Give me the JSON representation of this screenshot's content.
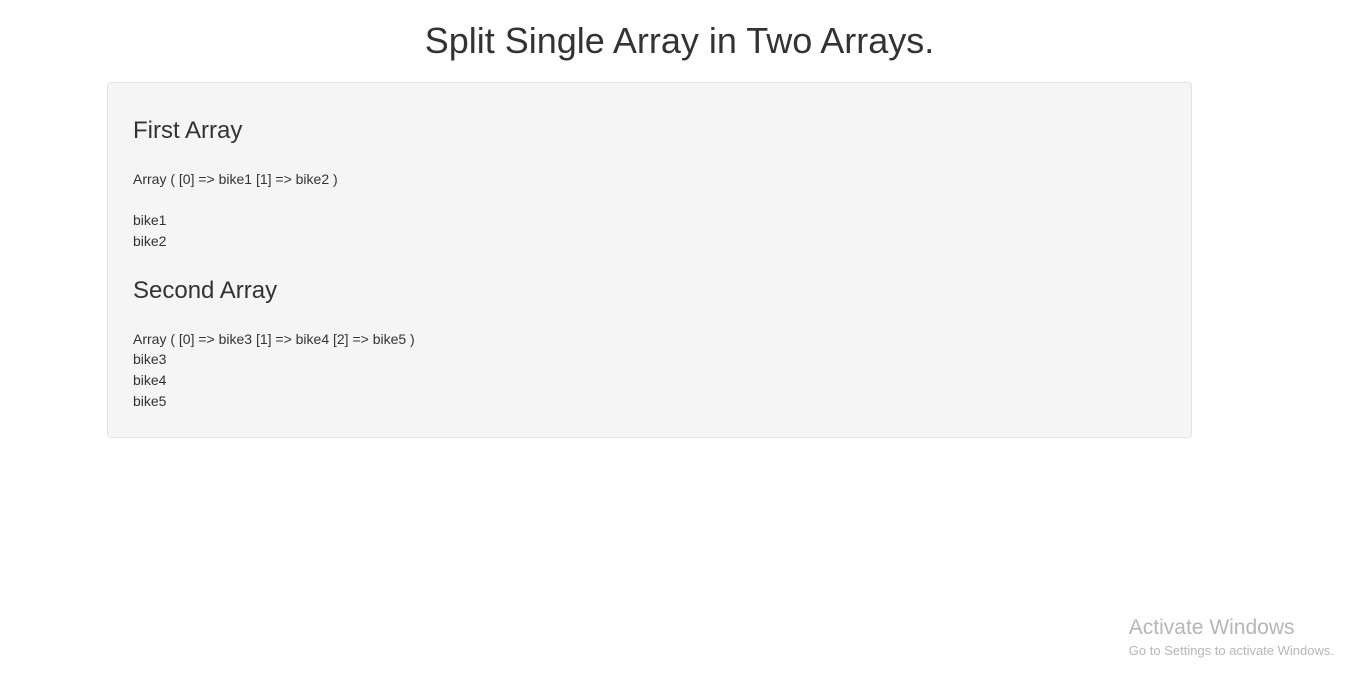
{
  "page_title": "Split Single Array in Two Arrays.",
  "first_array": {
    "heading": "First Array",
    "dump": "Array ( [0] => bike1 [1] => bike2 )",
    "items": [
      "bike1",
      "bike2"
    ]
  },
  "second_array": {
    "heading": "Second Array",
    "dump": "Array ( [0] => bike3 [1] => bike4 [2] => bike5 )",
    "items": [
      "bike3",
      "bike4",
      "bike5"
    ]
  },
  "watermark": {
    "title": "Activate Windows",
    "subtitle": "Go to Settings to activate Windows."
  }
}
